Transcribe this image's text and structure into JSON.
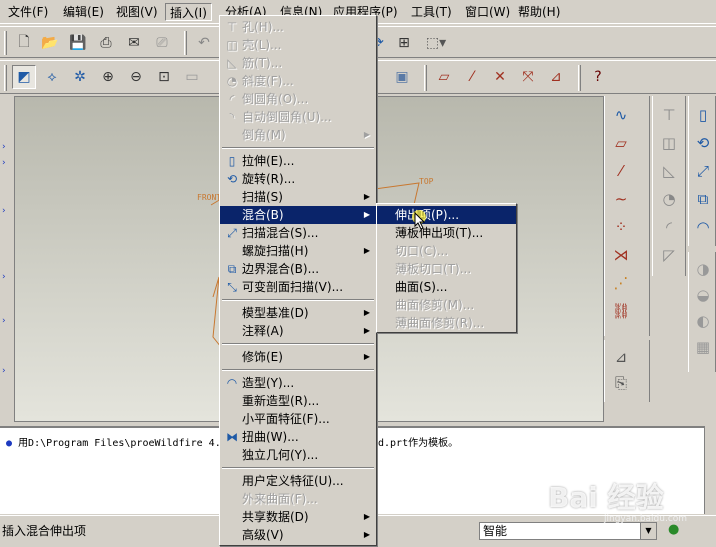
{
  "menubar": {
    "items": [
      "文件(F)",
      "编辑(E)",
      "视图(V)",
      "插入(I)",
      "分析(A)",
      "信息(N)",
      "应用程序(P)",
      "工具(T)",
      "窗口(W)",
      "帮助(H)"
    ]
  },
  "insert_menu": {
    "items": [
      {
        "label": "孔(H)...",
        "icon": "hole-icon"
      },
      {
        "label": "壳(L)...",
        "icon": "shell-icon"
      },
      {
        "label": "筋(T)...",
        "icon": "rib-icon"
      },
      {
        "label": "斜度(F)...",
        "icon": "draft-icon"
      },
      {
        "label": "倒圆角(O)...",
        "icon": "round-icon"
      },
      {
        "label": "自动倒圆角(U)...",
        "icon": "auto-round-icon"
      },
      {
        "label": "倒角(M)",
        "icon": ""
      },
      {
        "label": "拉伸(E)...",
        "icon": "extrude-icon"
      },
      {
        "label": "旋转(R)...",
        "icon": "revolve-icon"
      },
      {
        "label": "扫描(S)",
        "icon": ""
      },
      {
        "label": "混合(B)",
        "icon": ""
      },
      {
        "label": "扫描混合(S)...",
        "icon": "swept-blend-icon"
      },
      {
        "label": "螺旋扫描(H)",
        "icon": ""
      },
      {
        "label": "边界混合(B)...",
        "icon": "boundary-blend-icon"
      },
      {
        "label": "可变剖面扫描(V)...",
        "icon": "var-section-sweep-icon"
      },
      {
        "label": "模型基准(D)",
        "icon": ""
      },
      {
        "label": "注释(A)",
        "icon": ""
      },
      {
        "label": "修饰(E)",
        "icon": ""
      },
      {
        "label": "造型(Y)...",
        "icon": "style-icon"
      },
      {
        "label": "重新造型(R)...",
        "icon": ""
      },
      {
        "label": "小平面特征(F)...",
        "icon": ""
      },
      {
        "label": "扭曲(W)...",
        "icon": "warp-icon"
      },
      {
        "label": "独立几何(Y)...",
        "icon": ""
      },
      {
        "label": "用户定义特征(U)...",
        "icon": ""
      },
      {
        "label": "外来曲面(F)...",
        "icon": ""
      },
      {
        "label": "共享数据(D)",
        "icon": ""
      },
      {
        "label": "高级(V)",
        "icon": ""
      }
    ]
  },
  "blend_submenu": {
    "items": [
      "伸出项(P)...",
      "薄板伸出项(T)...",
      "切口(C)...",
      "薄板切口(T)...",
      "曲面(S)...",
      "曲面修剪(M)...",
      "薄曲面修剪(R)..."
    ]
  },
  "canvas": {
    "datum_front": "FRONT",
    "datum_top": "TOP"
  },
  "message": {
    "bullet": "●",
    "text_left": "用D:\\Program Files\\proeWildfire 4.",
    "text_right": "d.prt作为模板。"
  },
  "status": {
    "text": "插入混合伸出项",
    "filter_value": "智能"
  },
  "watermark": {
    "text": "Bai  经验",
    "sub": "jingyan.baidu.com"
  }
}
